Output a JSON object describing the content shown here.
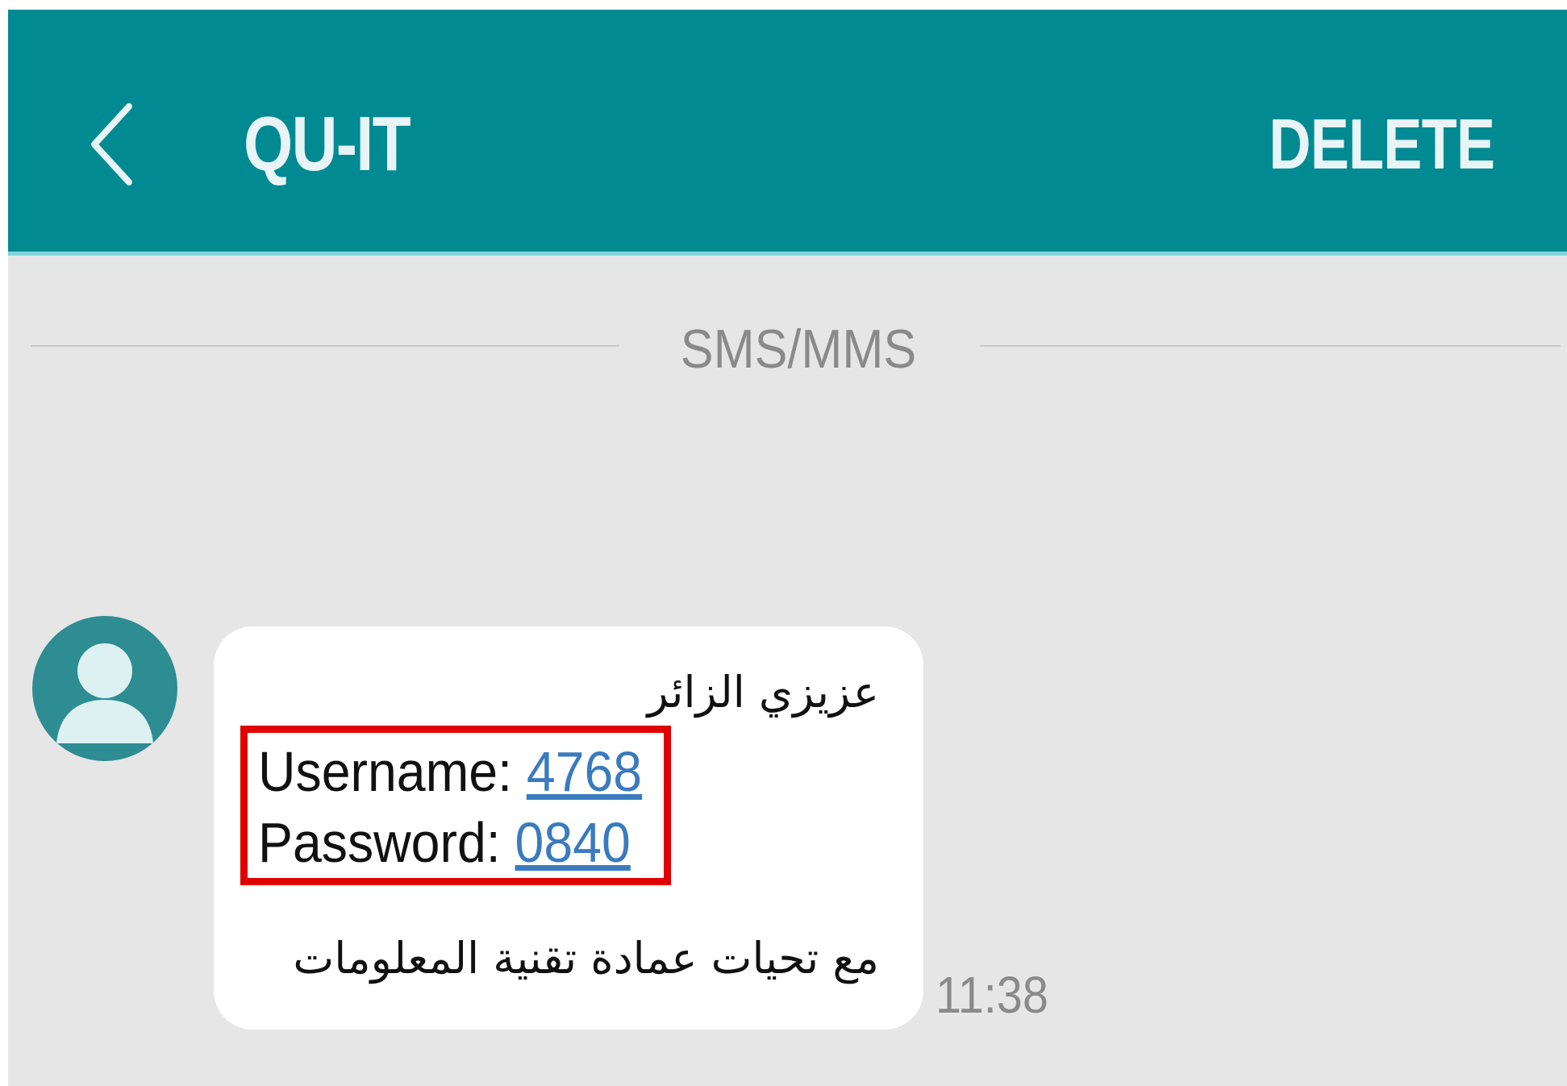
{
  "header": {
    "back_icon": "chevron-left-icon",
    "title": "QU-IT",
    "action_label": "DELETE"
  },
  "conversation": {
    "channel_label": "SMS/MMS"
  },
  "message": {
    "avatar_icon": "person-avatar-icon",
    "greeting": "عزيزي الزائر",
    "username_label": "Username: ",
    "username_value": "4768",
    "password_label": "Password: ",
    "password_value": "0840",
    "closing": "مع تحيات عمادة تقنية المعلومات",
    "time": "11:38"
  },
  "colors": {
    "appbar": "#028a93",
    "background": "#e6e6e6",
    "link": "#3a7bbf",
    "highlight": "#e00000"
  }
}
